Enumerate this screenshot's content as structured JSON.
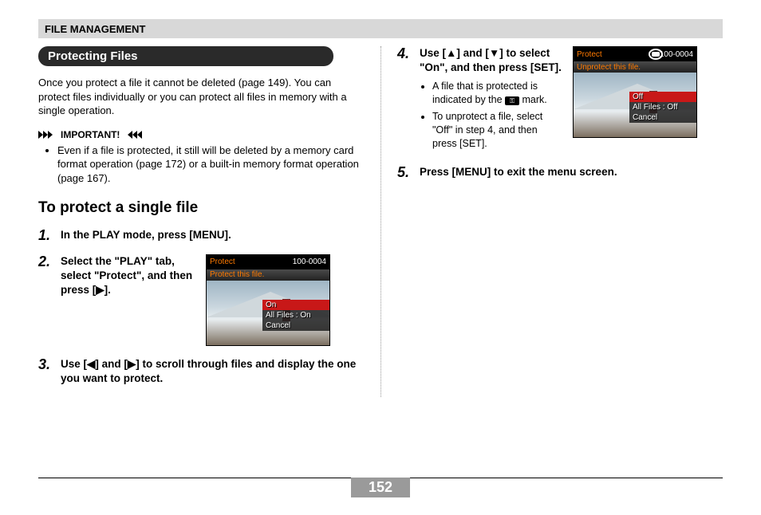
{
  "header": "FILE MANAGEMENT",
  "section_title": "Protecting Files",
  "intro": "Once you protect a file it cannot be deleted (page 149). You can protect files individually or you can protect all files in memory with a single operation.",
  "important_label": "IMPORTANT!",
  "important_bullet": "Even if a file is protected, it still will be deleted by a memory card format operation (page 172) or a built-in memory format operation (page 167).",
  "sub_heading": "To protect a single file",
  "steps": {
    "s1": {
      "num": "1.",
      "text": "In the PLAY mode, press [MENU]."
    },
    "s2": {
      "num": "2.",
      "text": "Select the \"PLAY\" tab, select \"Protect\", and then press [▶]."
    },
    "s3": {
      "num": "3.",
      "text": "Use [◀] and [▶] to scroll through files and display the one you want to protect."
    },
    "s4": {
      "num": "4.",
      "text": "Use [▲] and [▼] to select \"On\", and then press [SET].",
      "sub1_a": "A file that is protected is indicated by the ",
      "sub1_b": " mark.",
      "sub2": "To unprotect a file, select \"Off\" in step 4, and then press [SET]."
    },
    "s5": {
      "num": "5.",
      "text": "Press [MENU] to exit the menu screen."
    }
  },
  "screen1": {
    "title": "Protect",
    "folder": "100-0004",
    "sub": "Protect this file.",
    "menu": [
      "On",
      "All Files : On",
      "Cancel"
    ],
    "highlight": 0
  },
  "screen2": {
    "title": "Protect",
    "folder": "100-0004",
    "sub": "Unprotect this file.",
    "menu": [
      "Off",
      "All Files : Off",
      "Cancel"
    ],
    "highlight": 0
  },
  "page_number": "152"
}
